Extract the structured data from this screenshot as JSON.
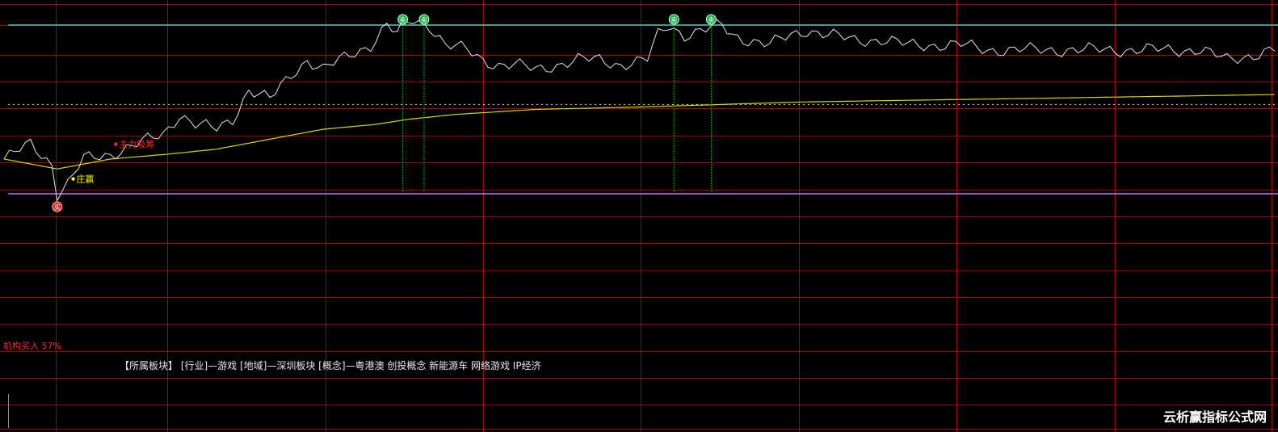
{
  "chart_data": {
    "type": "line",
    "x_count": 240,
    "ylim": [
      0,
      100
    ],
    "grid": true,
    "colors": {
      "background": "#000000",
      "grid": "#b00000",
      "price": "#e6e6e6",
      "avg": "#d8d800",
      "resistance": "#3fc8c8",
      "support": "#c070ff",
      "signal": "#00c800",
      "buy_dot": "#ff2020",
      "label_red": "#ff2a2a",
      "label_yellow": "#ffff00"
    },
    "resistance_level": 97,
    "support_level": 63,
    "dotted_level": 81,
    "price_keypoints": [
      [
        0,
        70
      ],
      [
        5,
        73
      ],
      [
        9,
        69
      ],
      [
        10,
        63
      ],
      [
        12,
        65
      ],
      [
        15,
        70
      ],
      [
        20,
        71
      ],
      [
        25,
        73
      ],
      [
        30,
        75
      ],
      [
        33,
        79
      ],
      [
        36,
        77
      ],
      [
        40,
        76
      ],
      [
        43,
        78
      ],
      [
        46,
        84
      ],
      [
        50,
        82
      ],
      [
        54,
        87
      ],
      [
        57,
        90
      ],
      [
        60,
        88
      ],
      [
        65,
        91
      ],
      [
        69,
        93
      ],
      [
        72,
        97
      ],
      [
        74,
        95
      ],
      [
        75,
        97
      ],
      [
        77,
        98
      ],
      [
        80,
        97
      ],
      [
        83,
        93
      ],
      [
        87,
        92
      ],
      [
        90,
        90
      ],
      [
        93,
        89
      ],
      [
        96,
        89
      ],
      [
        100,
        88
      ],
      [
        104,
        89
      ],
      [
        108,
        90
      ],
      [
        112,
        90
      ],
      [
        116,
        89
      ],
      [
        121,
        90
      ],
      [
        123,
        95
      ],
      [
        125,
        97
      ],
      [
        128,
        95
      ],
      [
        132,
        96
      ],
      [
        135,
        97
      ],
      [
        137,
        95
      ],
      [
        140,
        94
      ],
      [
        144,
        93
      ],
      [
        148,
        95
      ],
      [
        151,
        96
      ],
      [
        155,
        95
      ],
      [
        160,
        94
      ],
      [
        165,
        94
      ],
      [
        170,
        93
      ],
      [
        175,
        93
      ],
      [
        180,
        93
      ],
      [
        185,
        92
      ],
      [
        190,
        92
      ],
      [
        195,
        92
      ],
      [
        200,
        92
      ],
      [
        205,
        92
      ],
      [
        210,
        92
      ],
      [
        215,
        92
      ],
      [
        220,
        92
      ],
      [
        225,
        92
      ],
      [
        230,
        90
      ],
      [
        235,
        91
      ],
      [
        239,
        92
      ]
    ],
    "avg_keypoints": [
      [
        0,
        70
      ],
      [
        10,
        68
      ],
      [
        20,
        70
      ],
      [
        31,
        71
      ],
      [
        40,
        72
      ],
      [
        45,
        73
      ],
      [
        55,
        75
      ],
      [
        60,
        76
      ],
      [
        70,
        77
      ],
      [
        76,
        78
      ],
      [
        85,
        79
      ],
      [
        100,
        80
      ],
      [
        120,
        80.5
      ],
      [
        150,
        81.5
      ],
      [
        180,
        82
      ],
      [
        210,
        82.5
      ],
      [
        239,
        83
      ]
    ],
    "signals": [
      {
        "x": 10,
        "kind": "buy",
        "label": "买"
      },
      {
        "x": 75,
        "kind": "sell",
        "label": "卖"
      },
      {
        "x": 79,
        "kind": "sell",
        "label": "卖"
      },
      {
        "x": 126,
        "kind": "sell",
        "label": "卖"
      },
      {
        "x": 133,
        "kind": "sell",
        "label": "卖"
      }
    ],
    "annotations": [
      {
        "x": 21,
        "y": 73,
        "text": "主力吸筹",
        "color": "red"
      },
      {
        "x": 13,
        "y": 66,
        "text": "庄赢",
        "color": "yellow"
      }
    ]
  },
  "buy_ratio_label": "机构买入 57%",
  "sector_info": "【所属板块】 [行业]—游戏 [地域]—深圳板块 [概念]—粤港澳 创投概念 新能源车 网络游戏 IP经济",
  "watermark": "云析赢指标公式网"
}
